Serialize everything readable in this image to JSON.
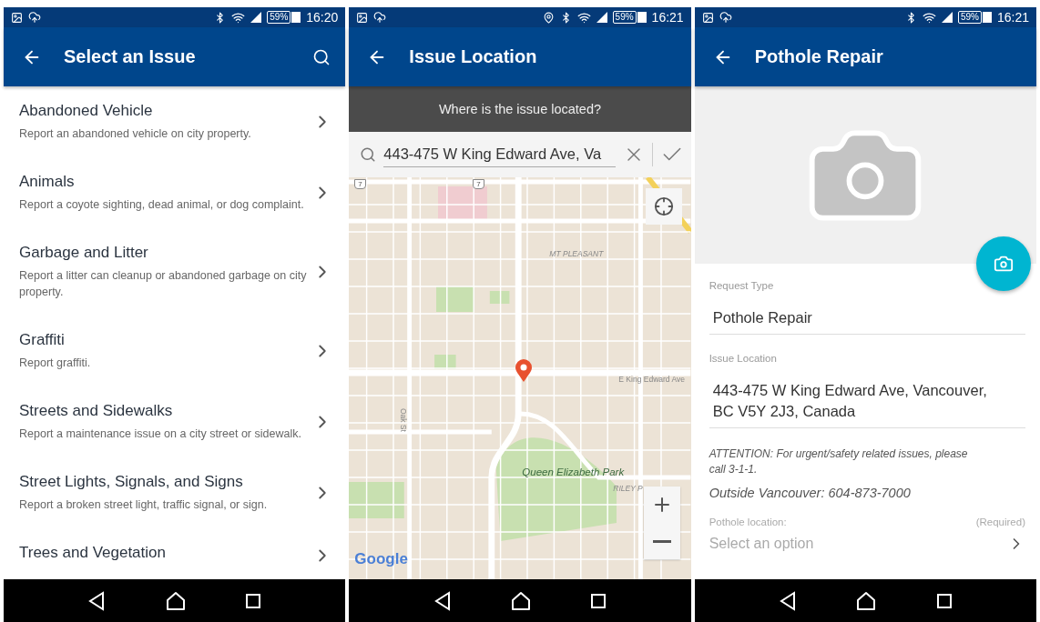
{
  "screens": [
    {
      "kind": "list",
      "status_bar": {
        "time": "16:20",
        "battery": "59%"
      },
      "app_bar": {
        "title": "Select an Issue",
        "search": true
      },
      "items": [
        {
          "title": "Abandoned Vehicle",
          "description": "Report an abandoned vehicle on city property."
        },
        {
          "title": "Animals",
          "description": "Report a coyote sighting, dead animal, or dog complaint."
        },
        {
          "title": "Garbage and Litter",
          "description": "Report a litter can cleanup or abandoned garbage on city property."
        },
        {
          "title": "Graffiti",
          "description": "Report graffiti."
        },
        {
          "title": "Streets and Sidewalks",
          "description": "Report a maintenance issue on a city street or sidewalk."
        },
        {
          "title": "Street Lights, Signals, and Signs",
          "description": "Report a broken street light, traffic signal, or sign."
        },
        {
          "title": "Trees and Vegetation"
        }
      ]
    },
    {
      "kind": "map",
      "status_bar": {
        "time": "16:21",
        "battery": "59%",
        "location": true
      },
      "app_bar": {
        "title": "Issue Location"
      },
      "banner": "Where is the issue located?",
      "search_field": {
        "value": "443-475 W King Edward Ave, Va"
      },
      "map_labels": [
        {
          "kind": "shield",
          "text": "7"
        },
        {
          "kind": "shield",
          "text": "7"
        },
        {
          "kind": "area",
          "text": "MT PLEASANT"
        },
        {
          "kind": "street",
          "text": "E King Edward Ave"
        },
        {
          "kind": "street-vertical",
          "text": "Oak St"
        },
        {
          "kind": "park",
          "text": "Queen Elizabeth Park"
        },
        {
          "kind": "area",
          "text": "RILEY P"
        },
        {
          "kind": "brand",
          "text": "Google"
        }
      ]
    },
    {
      "kind": "form",
      "status_bar": {
        "time": "16:21",
        "battery": "59%"
      },
      "app_bar": {
        "title": "Pothole Repair"
      },
      "fields": [
        {
          "label": "Request Type",
          "value": "Pothole Repair"
        },
        {
          "label": "Issue Location",
          "value": "443-475 W King Edward Ave, Vancouver, BC V5Y 2J3, Canada"
        }
      ],
      "notes": [
        "ATTENTION:  For urgent/safety related issues, please call 3-1-1.",
        "Outside Vancouver: 604-873-7000"
      ],
      "select": {
        "label": "Pothole location:",
        "required": "(Required)",
        "placeholder": "Select an option"
      }
    }
  ]
}
